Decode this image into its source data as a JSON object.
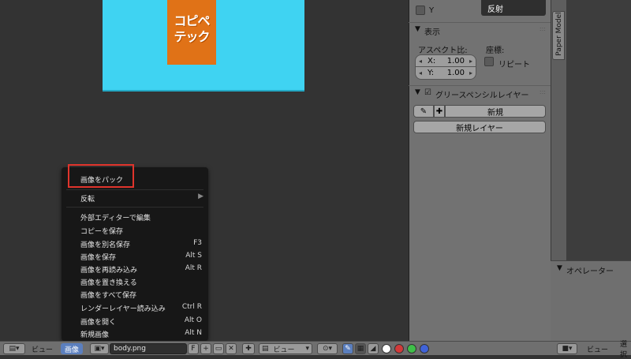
{
  "image": {
    "logo_line1": "コピペ",
    "logo_line2": "テック",
    "bg_color": "#3fd3f2",
    "logo_color": "#e07217"
  },
  "props": {
    "y_checkbox_label": "Y",
    "reflect_button": "反射",
    "display_panel": {
      "title": "表示",
      "aspect_label": "アスペクト比:",
      "coord_label": "座標:",
      "x_label": "X:",
      "x_value": "1.00",
      "y_label": "Y:",
      "y_value": "1.00",
      "repeat_label": "リピート"
    },
    "grease_panel": {
      "title": "グリースペンシルレイヤー",
      "new_label": "新規",
      "new_layer_label": "新規レイヤー"
    }
  },
  "side_tab": {
    "label": "Paper Model"
  },
  "operator": {
    "title": "オペレーター"
  },
  "context_menu": {
    "items": [
      {
        "label": "画像をパック",
        "shortcut": ""
      },
      {
        "label": "反転",
        "shortcut": "",
        "submenu": true
      },
      {
        "label": "外部エディターで編集",
        "shortcut": ""
      },
      {
        "label": "コピーを保存",
        "shortcut": ""
      },
      {
        "label": "画像を別名保存",
        "shortcut": "F3"
      },
      {
        "label": "画像を保存",
        "shortcut": "Alt S"
      },
      {
        "label": "画像を再読み込み",
        "shortcut": "Alt R"
      },
      {
        "label": "画像を置き換える",
        "shortcut": ""
      },
      {
        "label": "画像をすべて保存",
        "shortcut": ""
      },
      {
        "label": "レンダーレイヤー読み込み",
        "shortcut": "Ctrl R"
      },
      {
        "label": "画像を開く",
        "shortcut": "Alt O"
      },
      {
        "label": "新規画像",
        "shortcut": "Alt N"
      }
    ]
  },
  "bottombar": {
    "view_menu": "ビュー",
    "image_menu": "画像",
    "image_name": "body.png",
    "fake_user": "F",
    "view_mode": "ビュー",
    "right_view": "ビュー",
    "right_select": "選択"
  }
}
